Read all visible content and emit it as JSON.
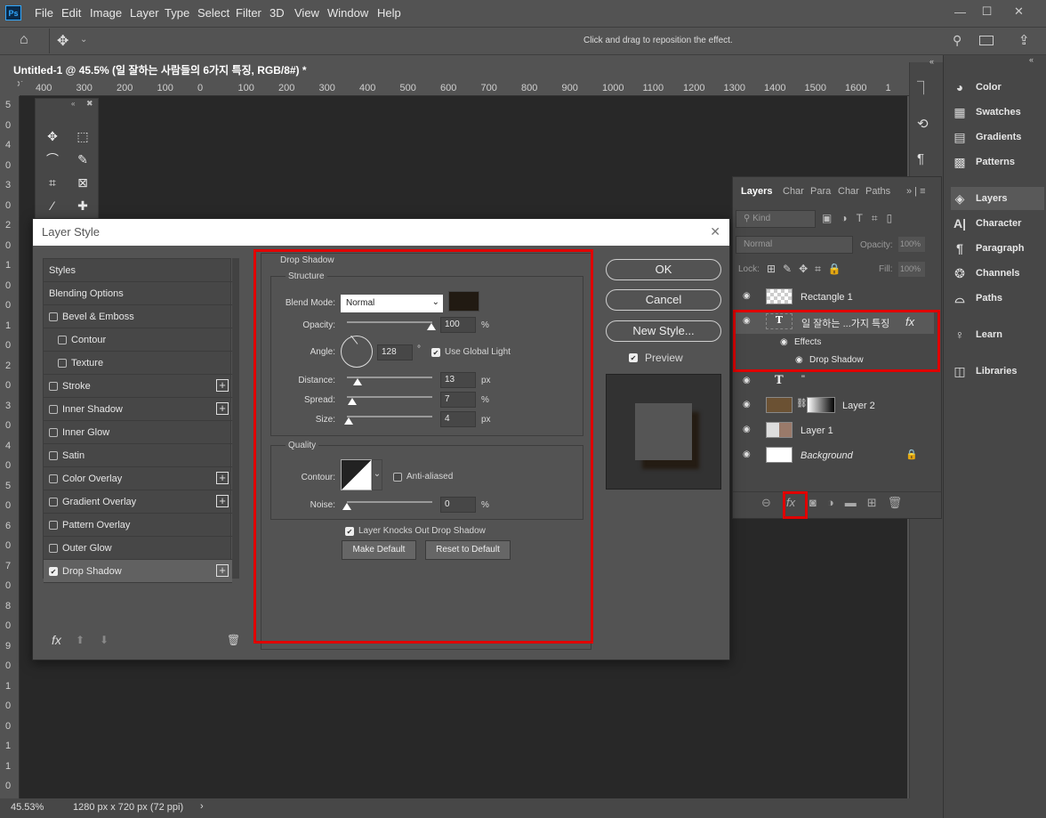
{
  "app": {
    "logo": "Ps",
    "menu": [
      "File",
      "Edit",
      "Image",
      "Layer",
      "Type",
      "Select",
      "Filter",
      "3D",
      "View",
      "Window",
      "Help"
    ],
    "window_buttons": [
      "—",
      "☐",
      "✕"
    ]
  },
  "options": {
    "hint": "Click and drag to reposition the effect."
  },
  "document": {
    "tab_title": "Untitled-1 @ 45.5% (일 잘하는 사람들의  6가지 특징, RGB/8#) *",
    "close": "×"
  },
  "ruler": {
    "h": [
      "400",
      "300",
      "200",
      "100",
      "0",
      "100",
      "200",
      "300",
      "400",
      "500",
      "600",
      "700",
      "800",
      "900",
      "1000",
      "1100",
      "1200",
      "1300",
      "1400",
      "1500",
      "1600",
      "1"
    ],
    "v": [
      "5",
      "0",
      "4",
      "0",
      "3",
      "0",
      "2",
      "0",
      "1",
      "0",
      "0",
      "1",
      "0",
      "2",
      "0",
      "3",
      "0",
      "4",
      "0",
      "5",
      "0",
      "6",
      "0",
      "7",
      "0",
      "8",
      "0",
      "9",
      "0",
      "1",
      "0",
      "0",
      "1",
      "1",
      "0"
    ]
  },
  "status": {
    "zoom": "45.53%",
    "size": "1280 px x 720 px (72 ppi)",
    "arrow": "›"
  },
  "right_panel": {
    "items": [
      {
        "icon": "color-icon",
        "label": "Color"
      },
      {
        "icon": "swatches-icon",
        "label": "Swatches"
      },
      {
        "icon": "gradients-icon",
        "label": "Gradients"
      },
      {
        "icon": "patterns-icon",
        "label": "Patterns"
      },
      {
        "icon": "layers-icon",
        "label": "Layers"
      },
      {
        "icon": "character-icon",
        "label": "Character"
      },
      {
        "icon": "paragraph-icon",
        "label": "Paragraph"
      },
      {
        "icon": "channels-icon",
        "label": "Channels"
      },
      {
        "icon": "paths-icon",
        "label": "Paths"
      },
      {
        "icon": "learn-icon",
        "label": "Learn"
      },
      {
        "icon": "libraries-icon",
        "label": "Libraries"
      }
    ]
  },
  "layers_panel": {
    "tabs": [
      "Layers",
      "Char",
      "Para",
      "Char",
      "Paths"
    ],
    "kind": "Kind",
    "blend": "Normal",
    "opacity_label": "Opacity:",
    "opacity": "100%",
    "lock_label": "Lock:",
    "fill_label": "Fill:",
    "fill": "100%",
    "layers": [
      {
        "name": "Rectangle 1"
      },
      {
        "name": "일 잘하는 ...가지 특징",
        "fx": "fx"
      },
      {
        "name": "Effects"
      },
      {
        "name": "Drop Shadow"
      },
      {
        "name": "\""
      },
      {
        "name": "Layer 2"
      },
      {
        "name": "Layer 1"
      },
      {
        "name": "Background"
      }
    ]
  },
  "dialog": {
    "title": "Layer Style",
    "close": "✕",
    "styles": [
      {
        "label": "Styles"
      },
      {
        "label": "Blending Options"
      },
      {
        "label": "Bevel & Emboss",
        "check": true
      },
      {
        "label": "Contour",
        "check": true
      },
      {
        "label": "Texture",
        "check": true
      },
      {
        "label": "Stroke",
        "check": true,
        "plus": true
      },
      {
        "label": "Inner Shadow",
        "check": true,
        "plus": true
      },
      {
        "label": "Inner Glow",
        "check": true
      },
      {
        "label": "Satin",
        "check": true
      },
      {
        "label": "Color Overlay",
        "check": true,
        "plus": true
      },
      {
        "label": "Gradient Overlay",
        "check": true,
        "plus": true
      },
      {
        "label": "Pattern Overlay",
        "check": true
      },
      {
        "label": "Outer Glow",
        "check": true
      },
      {
        "label": "Drop Shadow",
        "check": true,
        "checked": true,
        "plus": true
      }
    ],
    "footer_fx": "fx",
    "section_title": "Drop Shadow",
    "structure": "Structure",
    "blend_label": "Blend Mode:",
    "blend_value": "Normal",
    "shadow_color": "#211a12",
    "opacity_label": "Opacity:",
    "opacity_value": "100",
    "opacity_pct": 1.0,
    "angle_label": "Angle:",
    "angle_value": "128",
    "angle_unit": "°",
    "global_light": "Use Global Light",
    "distance_label": "Distance:",
    "distance_value": "13",
    "spread_label": "Spread:",
    "spread_value": "7",
    "size_label": "Size:",
    "size_value": "4",
    "px": "px",
    "pct": "%",
    "quality": "Quality",
    "contour_label": "Contour:",
    "anti_aliased": "Anti-aliased",
    "noise_label": "Noise:",
    "noise_value": "0",
    "knocks_out": "Layer Knocks Out Drop Shadow",
    "make_default": "Make Default",
    "reset_default": "Reset to Default",
    "ok": "OK",
    "cancel": "Cancel",
    "new_style": "New Style...",
    "preview": "Preview"
  }
}
